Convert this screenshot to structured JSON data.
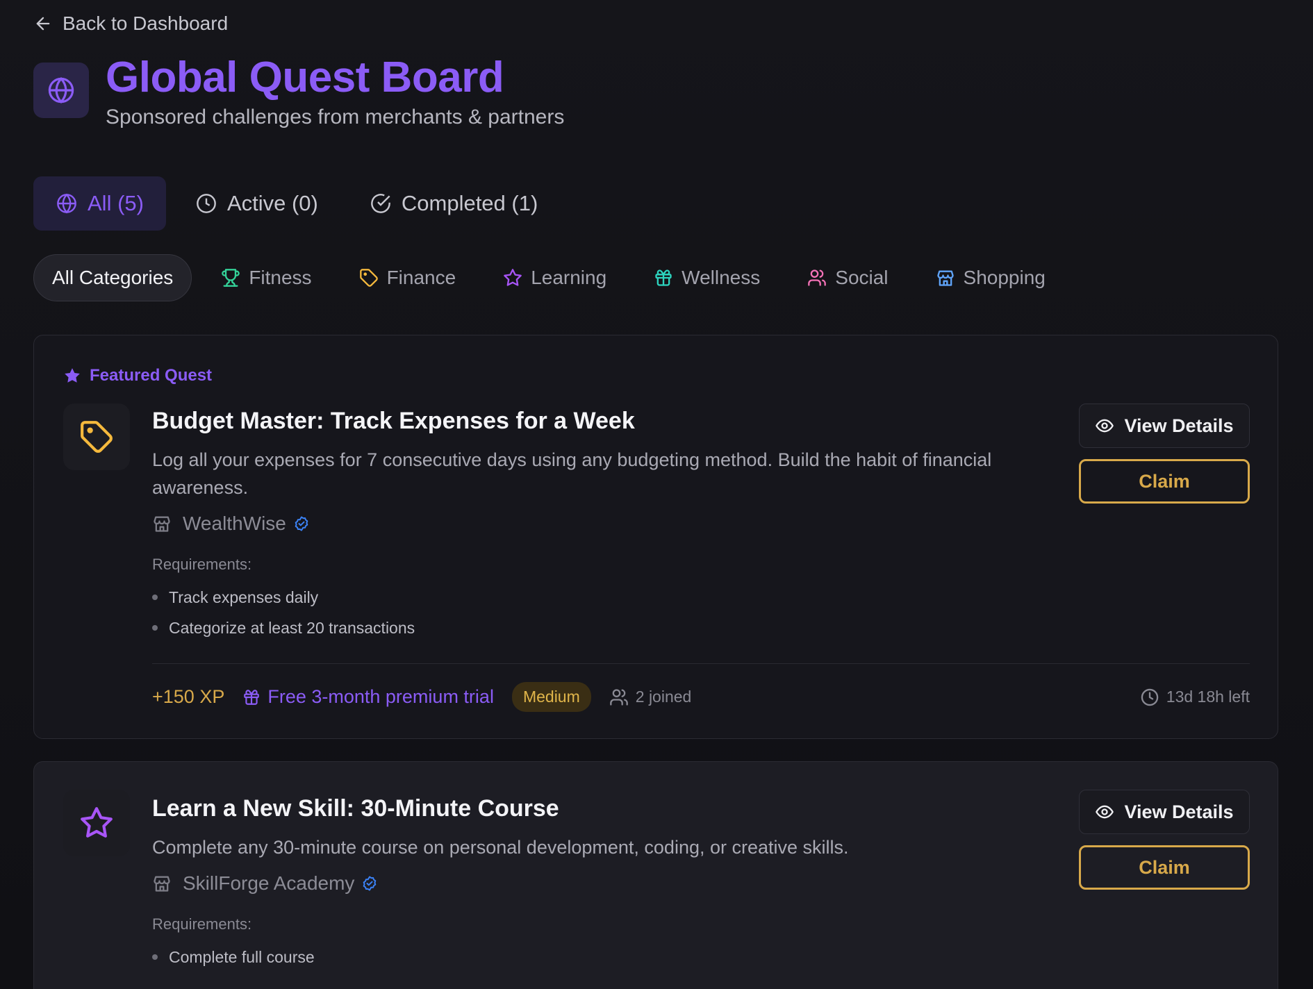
{
  "nav": {
    "back_label": "Back to Dashboard"
  },
  "header": {
    "title": "Global Quest Board",
    "subtitle": "Sponsored challenges from merchants & partners",
    "icon": "globe-icon"
  },
  "tabs": [
    {
      "label": "All (5)",
      "icon": "globe-icon",
      "active": true
    },
    {
      "label": "Active (0)",
      "icon": "clock-icon",
      "active": false
    },
    {
      "label": "Completed (1)",
      "icon": "check-circle-icon",
      "active": false
    }
  ],
  "categories": [
    {
      "label": "All Categories",
      "active": true
    },
    {
      "label": "Fitness",
      "icon": "trophy-icon",
      "color": "#34d399"
    },
    {
      "label": "Finance",
      "icon": "tag-icon",
      "color": "#f5b93d"
    },
    {
      "label": "Learning",
      "icon": "star-icon",
      "color": "#a855f7"
    },
    {
      "label": "Wellness",
      "icon": "gift-icon",
      "color": "#2dd4bf"
    },
    {
      "label": "Social",
      "icon": "users-icon",
      "color": "#f472b6"
    },
    {
      "label": "Shopping",
      "icon": "store-icon",
      "color": "#60a5fa"
    }
  ],
  "quests": [
    {
      "featured_label": "Featured Quest",
      "icon": "tag-icon",
      "title": "Budget Master: Track Expenses for a Week",
      "description": "Log all your expenses for 7 consecutive days using any budgeting method. Build the habit of financial awareness.",
      "merchant": "WealthWise",
      "requirements_label": "Requirements:",
      "requirements": [
        "Track expenses daily",
        "Categorize at least 20 transactions"
      ],
      "xp": "+150 XP",
      "reward": "Free 3-month premium trial",
      "difficulty": "Medium",
      "joined": "2 joined",
      "time_left": "13d 18h left",
      "view_label": "View Details",
      "claim_label": "Claim"
    },
    {
      "icon": "star-icon",
      "title": "Learn a New Skill: 30-Minute Course",
      "description": "Complete any 30-minute course on personal development, coding, or creative skills.",
      "merchant": "SkillForge Academy",
      "requirements_label": "Requirements:",
      "requirements": [
        "Complete full course"
      ],
      "view_label": "View Details",
      "claim_label": "Claim"
    }
  ],
  "colors": {
    "accent": "#8b5cf6",
    "gold": "#d8a94a",
    "verified": "#3b82f6"
  }
}
